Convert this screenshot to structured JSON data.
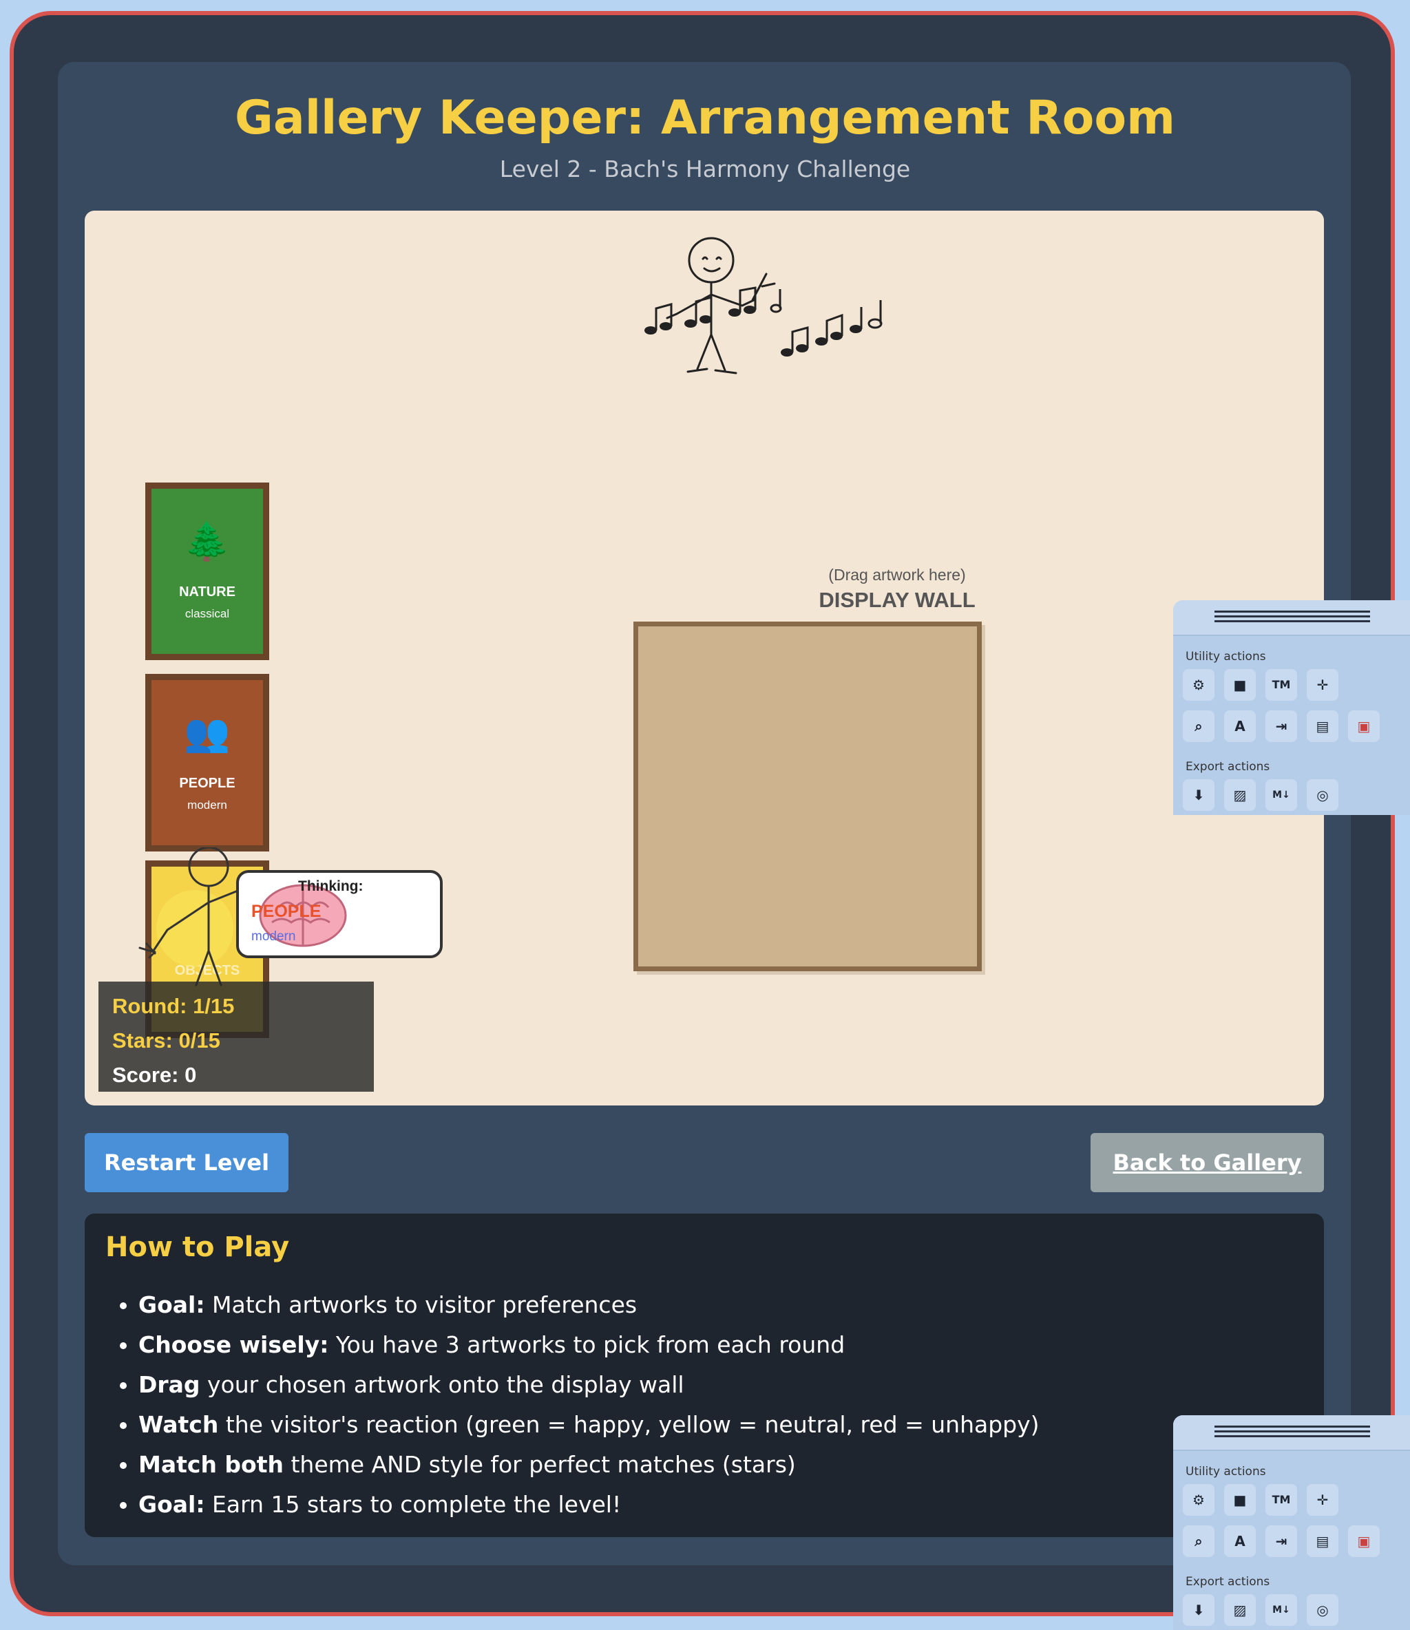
{
  "header": {
    "title": "Gallery Keeper: Arrangement Room",
    "subtitle": "Level 2 - Bach's Harmony Challenge"
  },
  "stage": {
    "artworks": [
      {
        "icon": "🌲",
        "theme": "NATURE",
        "style": "classical",
        "color": "#3f8f3a"
      },
      {
        "icon": "👥",
        "theme": "PEOPLE",
        "style": "modern",
        "color": "#a0522d"
      },
      {
        "icon": "",
        "theme": "OBJECTS",
        "style": "",
        "color": "#f5d44a"
      }
    ],
    "wall_hint": "(Drag artwork here)",
    "wall_label": "DISPLAY WALL",
    "thought": {
      "title": "Thinking:",
      "theme": "PEOPLE",
      "style": "modern"
    },
    "stats": {
      "round": "Round: 1/15",
      "stars": "Stars: 0/15",
      "score": "Score: 0"
    }
  },
  "buttons": {
    "restart": "Restart Level",
    "back": "Back to Gallery"
  },
  "how_to": {
    "heading": "How to Play",
    "items": [
      {
        "bold": "Goal:",
        "text": " Match artworks to visitor preferences"
      },
      {
        "bold": "Choose wisely:",
        "text": " You have 3 artworks to pick from each round"
      },
      {
        "bold": "Drag",
        "text": " your chosen artwork onto the display wall"
      },
      {
        "bold": "Watch",
        "text": " the visitor's reaction (green = happy, yellow = neutral, red = unhappy)"
      },
      {
        "bold": "Match both",
        "text": " theme AND style for perfect matches (stars)"
      },
      {
        "bold": "Goal:",
        "text": " Earn 15 stars to complete the level!"
      }
    ]
  },
  "toolbar": {
    "utility_label": "Utility actions",
    "export_label": "Export actions",
    "utility_row1": [
      "gear-icon",
      "robot-icon",
      "trademark-icon",
      "compress-icon"
    ],
    "utility_row2": [
      "search-icon",
      "text-recognize-icon",
      "file-import-icon",
      "file-code-icon",
      "save-icon"
    ],
    "export_row": [
      "download-icon",
      "image-export-icon",
      "markdown-icon",
      "screenshot-icon"
    ],
    "tm_text": "TM",
    "md_text": "M↓"
  },
  "colors": {
    "accent": "#f7cf45",
    "frame_border": "#d9534f",
    "restart": "#4a90d9",
    "back": "#98a3a5"
  }
}
